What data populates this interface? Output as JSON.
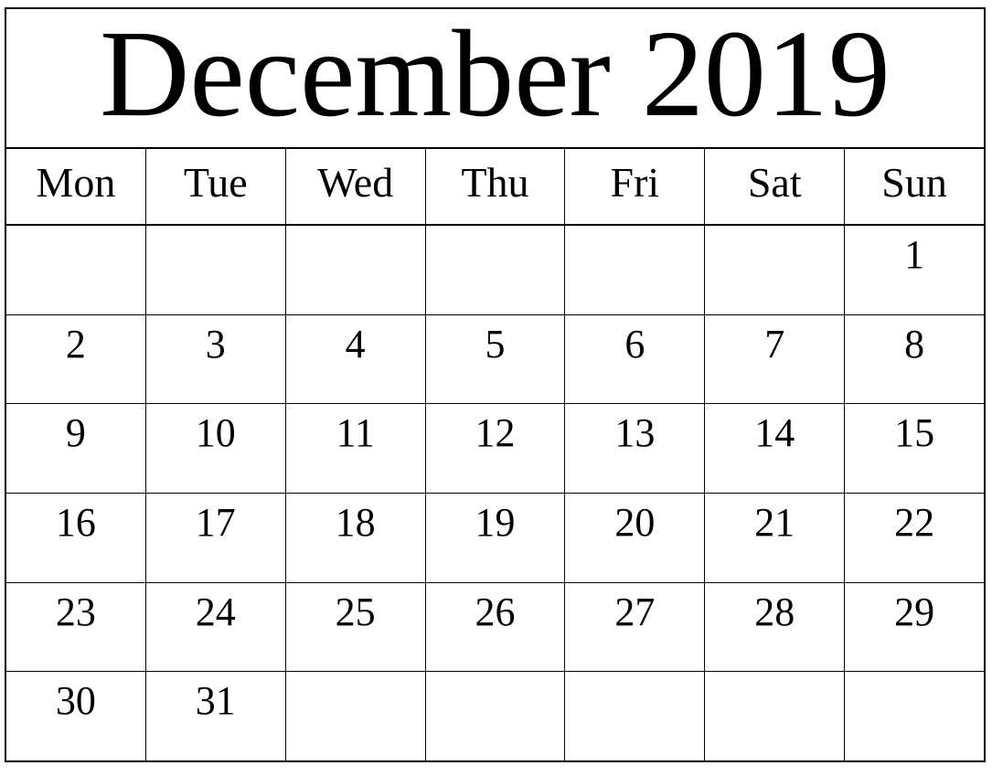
{
  "document": {
    "kind": "monthly-calendar",
    "title": "December 2019",
    "month": "December",
    "year": "2019",
    "week_start": "Mon",
    "ink_color": "#000000",
    "paper_color": "#ffffff"
  },
  "header": {
    "days": [
      {
        "label": "Mon"
      },
      {
        "label": "Tue"
      },
      {
        "label": "Wed"
      },
      {
        "label": "Thu"
      },
      {
        "label": "Fri"
      },
      {
        "label": "Sat"
      },
      {
        "label": "Sun"
      }
    ]
  },
  "weeks": [
    {
      "index": 1,
      "cells": [
        {
          "day": ""
        },
        {
          "day": ""
        },
        {
          "day": ""
        },
        {
          "day": ""
        },
        {
          "day": ""
        },
        {
          "day": ""
        },
        {
          "day": "1"
        }
      ]
    },
    {
      "index": 2,
      "cells": [
        {
          "day": "2"
        },
        {
          "day": "3"
        },
        {
          "day": "4"
        },
        {
          "day": "5"
        },
        {
          "day": "6"
        },
        {
          "day": "7"
        },
        {
          "day": "8"
        }
      ]
    },
    {
      "index": 3,
      "cells": [
        {
          "day": "9"
        },
        {
          "day": "10"
        },
        {
          "day": "11"
        },
        {
          "day": "12"
        },
        {
          "day": "13"
        },
        {
          "day": "14"
        },
        {
          "day": "15"
        }
      ]
    },
    {
      "index": 4,
      "cells": [
        {
          "day": "16"
        },
        {
          "day": "17"
        },
        {
          "day": "18"
        },
        {
          "day": "19"
        },
        {
          "day": "20"
        },
        {
          "day": "21"
        },
        {
          "day": "22"
        }
      ]
    },
    {
      "index": 5,
      "cells": [
        {
          "day": "23"
        },
        {
          "day": "24"
        },
        {
          "day": "25"
        },
        {
          "day": "26"
        },
        {
          "day": "27"
        },
        {
          "day": "28"
        },
        {
          "day": "29"
        }
      ]
    },
    {
      "index": 6,
      "cells": [
        {
          "day": "30"
        },
        {
          "day": "31"
        },
        {
          "day": ""
        },
        {
          "day": ""
        },
        {
          "day": ""
        },
        {
          "day": ""
        },
        {
          "day": ""
        }
      ]
    }
  ]
}
